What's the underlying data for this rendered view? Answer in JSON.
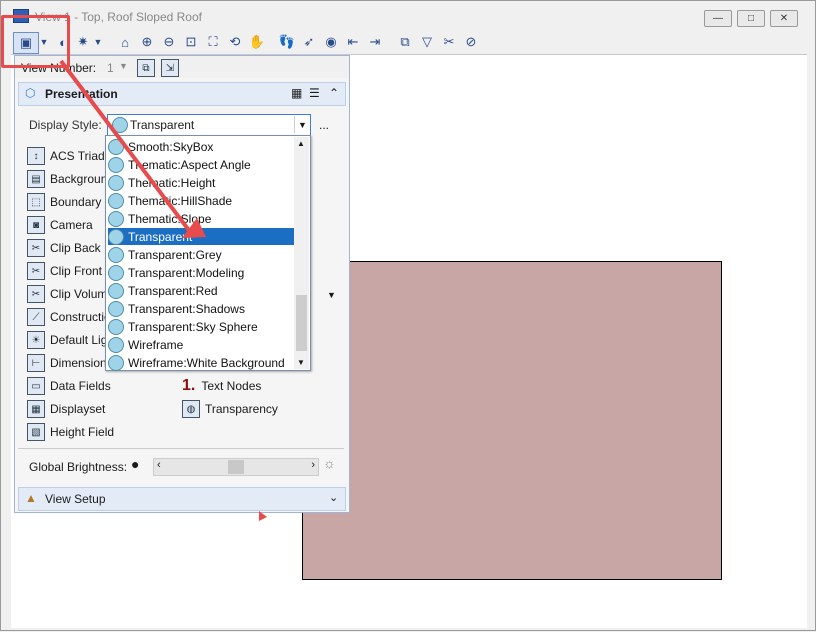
{
  "window": {
    "title": "View 1 - Top, Roof Sloped Roof",
    "minimize": "—",
    "maximize": "□",
    "close": "✕"
  },
  "view_number": {
    "label": "View Number:",
    "value": "1"
  },
  "presentation": {
    "title": "Presentation",
    "display_style_label": "Display Style:",
    "display_style_value": "Transparent",
    "more_button": "...",
    "left_items": [
      "ACS Triad",
      "Background",
      "Boundary D",
      "Camera",
      "Clip Back",
      "Clip Front",
      "Clip Volume",
      "Construction",
      "Default Light",
      "Dimensions",
      "Data Fields",
      "Displayset",
      "Height Field"
    ],
    "right_items": [
      "Text Nodes",
      "Transparency"
    ],
    "global_brightness_label": "Global Brightness:",
    "global_brightness_level": 0.5
  },
  "dropdown": {
    "options": [
      "Smooth:SkyBox",
      "Thematic:Aspect Angle",
      "Thematic:Height",
      "Thematic:HillShade",
      "Thematic:Slope",
      "Transparent",
      "Transparent:Grey",
      "Transparent:Modeling",
      "Transparent:Red",
      "Transparent:Shadows",
      "Transparent:Sky Sphere",
      "Wireframe",
      "Wireframe:White Background"
    ],
    "selected": "Transparent"
  },
  "view_setup": {
    "title": "View Setup"
  },
  "colors": {
    "accent": "#1b6ec2",
    "roof_fill": "#c9a6a6",
    "annotation_red": "#e84b4b"
  }
}
